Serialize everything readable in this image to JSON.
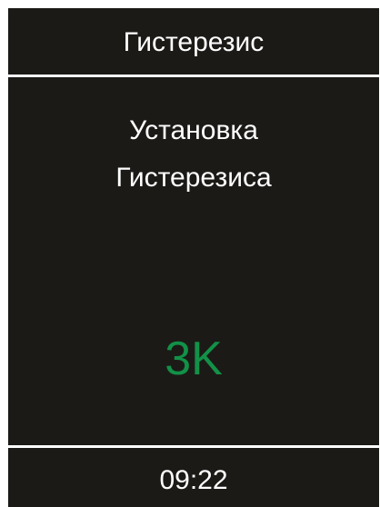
{
  "header": {
    "title": "Гистерезис"
  },
  "main": {
    "line1": "Установка",
    "line2": "Гистерезиса",
    "value": "3K"
  },
  "footer": {
    "time": "09:22"
  },
  "colors": {
    "background": "#1c1a17",
    "text": "#ffffff",
    "value": "#129147"
  }
}
